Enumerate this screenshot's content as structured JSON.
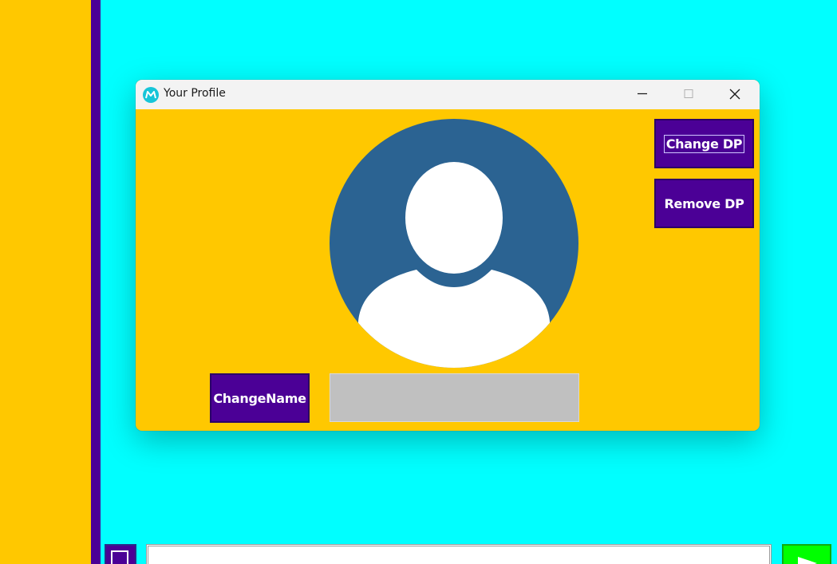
{
  "window": {
    "title": "Your Profile"
  },
  "profile": {
    "change_dp_label": "Change DP",
    "remove_dp_label": "Remove DP",
    "change_name_label": "ChangeName",
    "name_value": ""
  },
  "chat": {
    "message_value": ""
  },
  "colors": {
    "background": "#00ffff",
    "panel": "#ffc800",
    "accent": "#4b0096",
    "avatar": "#2b6392",
    "send": "#00ff00",
    "name_field": "#c0c0c0"
  },
  "icons": {
    "app": "app-logo-icon",
    "minimize": "minimize-icon",
    "maximize": "maximize-icon",
    "close": "close-icon",
    "avatar": "default-user-avatar",
    "send": "send-arrow-icon",
    "attach": "attach-icon"
  }
}
